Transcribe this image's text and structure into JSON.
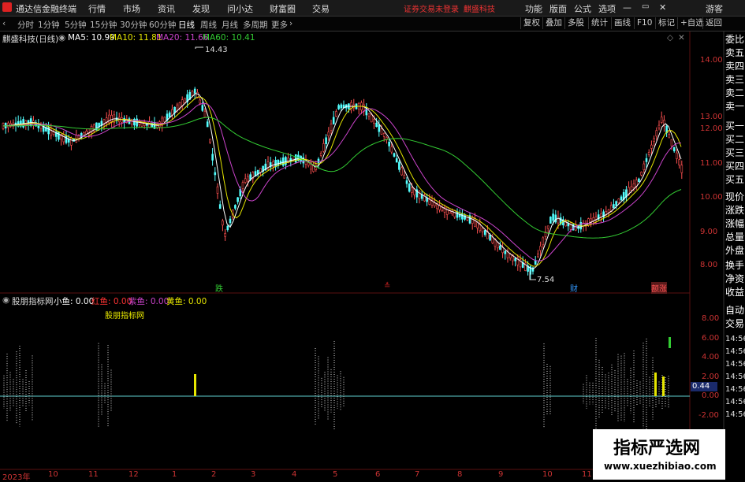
{
  "menubar": {
    "app_title": "通达信金融终端",
    "items": [
      "行情",
      "市场",
      "资讯",
      "发现",
      "问小达",
      "财富圈",
      "交易"
    ],
    "notice": "证券交易未登录",
    "stock": "麒盛科技",
    "right_items": [
      "功能",
      "版面",
      "公式",
      "选项"
    ],
    "guest": "游客"
  },
  "timeframes": [
    "分时",
    "1分钟",
    "5分钟",
    "15分钟",
    "30分钟",
    "60分钟",
    "日线",
    "周线",
    "月线",
    "多周期",
    "更多"
  ],
  "active_timeframe": "日线",
  "toolbar_right": [
    "复权",
    "叠加",
    "多股",
    "统计",
    "画线",
    "F10",
    "标记",
    "+自选",
    "返回"
  ],
  "main_chart": {
    "title": "麒盛科技(日线)",
    "ma": [
      {
        "label": "MA5: 10.99",
        "color": "#ffffff"
      },
      {
        "label": "MA10: 11.81",
        "color": "#e6e600"
      },
      {
        "label": "MA20: 11.66",
        "color": "#cc44cc"
      },
      {
        "label": "MA60: 10.41",
        "color": "#33cc33"
      }
    ],
    "high_label": "14.43",
    "low_label": "7.54",
    "price_ticks": [
      "14.00",
      "13.00",
      "12.00",
      "11.00",
      "10.00",
      "9.00",
      "8.00"
    ],
    "markers": [
      {
        "text": "跌",
        "color": "#33cc33"
      },
      {
        "text": "≛",
        "color": "#cc2222"
      },
      {
        "text": "财",
        "color": "#3399ff"
      },
      {
        "text": "额涨",
        "color": "#ff5555"
      }
    ]
  },
  "indicator": {
    "name": "股朋指标网",
    "values": [
      {
        "label": "小鱼: 0.00",
        "color": "#ffffff"
      },
      {
        "label": "红鱼: 0.00",
        "color": "#ff3333"
      },
      {
        "label": "紫鱼: 0.00",
        "color": "#cc44cc"
      },
      {
        "label": "黄鱼: 0.00",
        "color": "#e6e600"
      }
    ],
    "watermark_text": "股朋指标网",
    "ticks": [
      "8.00",
      "6.00",
      "4.00",
      "2.00",
      "0.00",
      "-2.00"
    ],
    "current_value": "0.44"
  },
  "sidebar": {
    "items": [
      "委比",
      "卖五",
      "卖四",
      "卖三",
      "卖二",
      "卖一",
      "买一",
      "买二",
      "买三",
      "买四",
      "买五",
      "现价",
      "涨跌",
      "涨幅",
      "总量",
      "外盘",
      "换手",
      "净资",
      "收益",
      "自动",
      "交易"
    ],
    "times": [
      "14:56",
      "14:56",
      "14:56",
      "14:56",
      "14:56",
      "14:56",
      "14:56"
    ]
  },
  "xaxis": [
    "2023年",
    "10",
    "11",
    "12",
    "1",
    "2",
    "3",
    "4",
    "5",
    "6",
    "7",
    "8",
    "9",
    "10",
    "11"
  ],
  "watermark": {
    "cn": "指标严选网",
    "url": "www.xuezhibiao.com"
  }
}
